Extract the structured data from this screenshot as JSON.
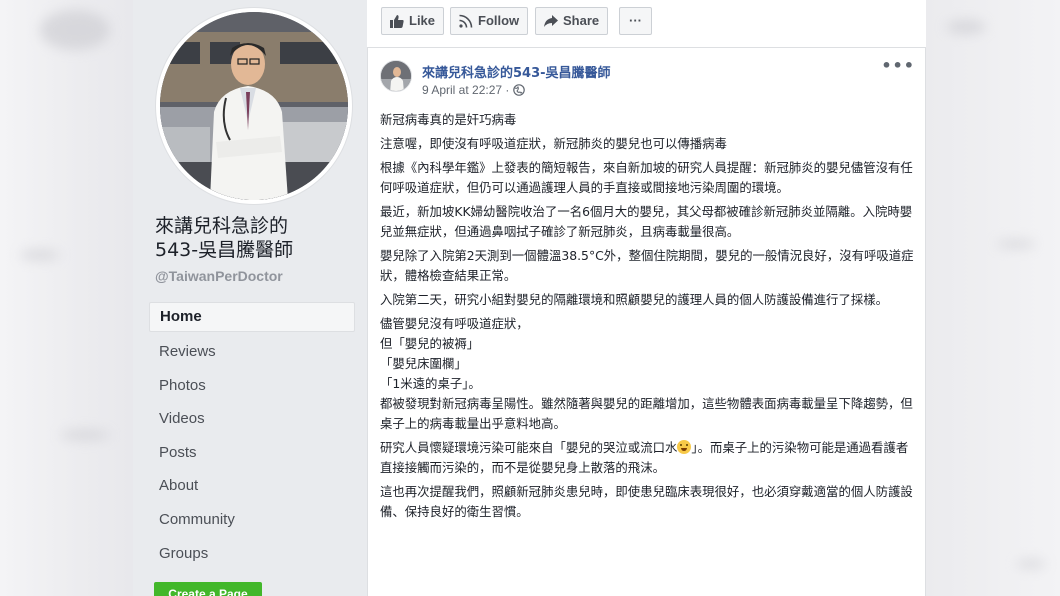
{
  "page": {
    "name": "來講兒科急診的543-吳昌騰醫師",
    "name_line1": "來講兒科急診的",
    "name_line2": "543-吳昌騰醫師",
    "handle": "@TaiwanPerDoctor"
  },
  "nav": {
    "items": [
      {
        "label": "Home",
        "active": true
      },
      {
        "label": "Reviews"
      },
      {
        "label": "Photos"
      },
      {
        "label": "Videos"
      },
      {
        "label": "Posts"
      },
      {
        "label": "About"
      },
      {
        "label": "Community"
      },
      {
        "label": "Groups"
      }
    ],
    "create_label": "Create a Page"
  },
  "actions": {
    "like_label": "Like",
    "follow_label": "Follow",
    "share_label": "Share",
    "more_label": "···"
  },
  "post": {
    "author": "來講兒科急診的543-吳昌騰醫師",
    "timestamp": "9 April at 22:27 ·",
    "more_label": "•••",
    "paragraphs": [
      "新冠病毒真的是奸巧病毒",
      "注意喔，即使沒有呼吸道症狀，新冠肺炎的嬰兒也可以傳播病毒",
      "根據《內科學年鑑》上發表的簡短報告，來自新加坡的研究人員提醒：新冠肺炎的嬰兒儘管沒有任何呼吸道症狀，但仍可以通過護理人員的手直接或間接地污染周圍的環境。",
      "最近，新加坡KK婦幼醫院收治了一名6個月大的嬰兒，其父母都被確診新冠肺炎並隔離。入院時嬰兒並無症狀，但通過鼻咽拭子確診了新冠肺炎，且病毒載量很高。",
      "嬰兒除了入院第2天測到一個體溫38.5°C外，整個住院期間，嬰兒的一般情況良好，沒有呼吸道症狀，體格檢查結果正常。",
      "入院第二天，研究小組對嬰兒的隔離環境和照顧嬰兒的護理人員的個人防護設備進行了採樣。",
      "儘管嬰兒沒有呼吸道症狀，",
      "但「嬰兒的被褥」",
      "「嬰兒床圍欄」",
      "「1米遠的桌子」。",
      "都被發現對新冠病毒呈陽性。雖然隨著與嬰兒的距離增加，這些物體表面病毒載量呈下降趨勢，但桌子上的病毒載量出乎意料地高。",
      "研究人員懷疑環境污染可能來自「嬰兒的哭泣或流口水",
      "」。而桌子上的污染物可能是通過看護者直接接觸而污染的，而不是從嬰兒身上散落的飛沫。",
      "這也再次提醒我們，照顧新冠肺炎患兒時，即使患兒臨床表現很好，也必須穿戴適當的個人防護設備、保持良好的衛生習慣。"
    ]
  },
  "colors": {
    "link": "#365899",
    "text": "#1d2129",
    "muted": "#90949c",
    "background": "#e9ebee",
    "create_button": "#42b72a"
  }
}
